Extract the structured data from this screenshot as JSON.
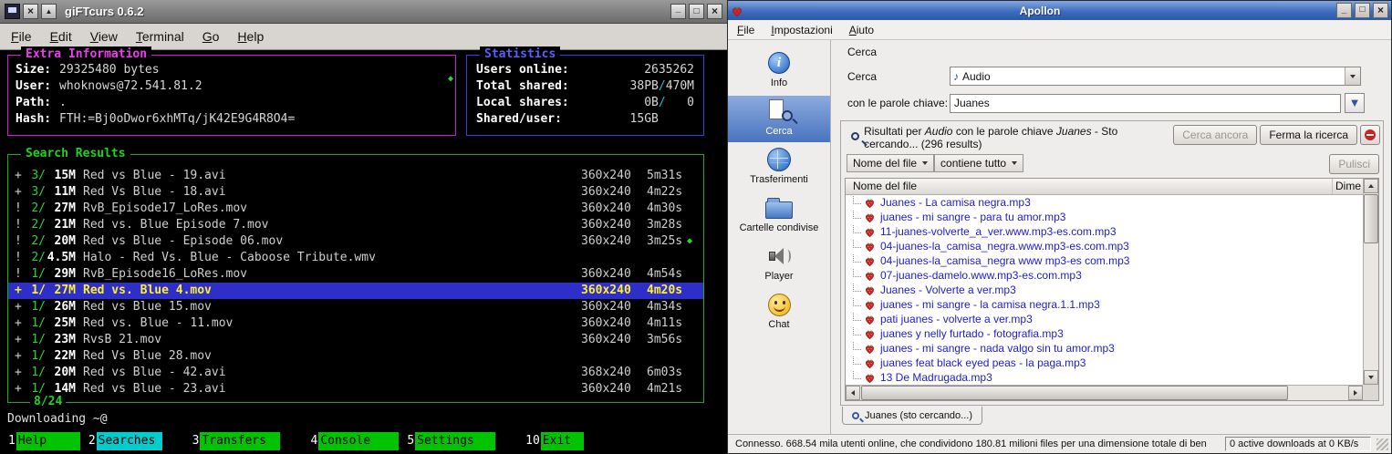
{
  "colors": {
    "terminal_green": "#1bd61b",
    "terminal_magenta": "#ee3cee",
    "terminal_blue": "#5d5dff",
    "terminal_cyan": "#18c5c5",
    "selection_bg": "#2e2ec9",
    "selection_fg": "#ffef2e",
    "fkey_green": "#00c400",
    "fkey_cyan": "#00cdcd",
    "kde_titlebar_blue": "#3c6dbd",
    "file_link_blue": "#2020c8"
  },
  "gift": {
    "window": {
      "title": "giFTcurs 0.6.2",
      "menu": [
        "File",
        "Edit",
        "View",
        "Terminal",
        "Go",
        "Help"
      ]
    },
    "extra_info": {
      "title": "Extra Information",
      "indicator": "◆",
      "rows": [
        {
          "label": "Size:",
          "value": "29325480 bytes"
        },
        {
          "label": "User:",
          "value": "whoknows@72.541.81.2"
        },
        {
          "label": "Path:",
          "value": "."
        },
        {
          "label": "Hash:",
          "value": "FTH:=Bj0oDwor6xhMTq/jK42E9G4R8O4="
        }
      ]
    },
    "statistics": {
      "title": "Statistics",
      "rows": [
        {
          "label": "Users online:",
          "v1": "2635262",
          "sl": "",
          "v2": ""
        },
        {
          "label": "Total shared:",
          "v1": "38PB",
          "sl": "/",
          "v2": "470M"
        },
        {
          "label": "Local shares:",
          "v1": "0B",
          "sl": "/",
          "v2": "   0"
        },
        {
          "label": "Shared/user:",
          "v1": "15GB     ",
          "sl": "",
          "v2": ""
        }
      ]
    },
    "search": {
      "title": "Search Results",
      "position": "8/24",
      "status_line": "Downloading ~@",
      "rows": [
        {
          "flag": "+",
          "count": "3/",
          "size": "15M",
          "name": "Red vs Blue - 19.avi",
          "res": "360x240",
          "time": "5m31s",
          "mark": "",
          "cls": ""
        },
        {
          "flag": "+",
          "count": "3/",
          "size": "11M",
          "name": "Red Vs Blue - 18.avi",
          "res": "360x240",
          "time": "4m22s",
          "mark": "",
          "cls": ""
        },
        {
          "flag": "!",
          "count": "2/",
          "size": "27M",
          "name": "RvB_Episode17_LoRes.mov",
          "res": "360x240",
          "time": "4m30s",
          "mark": "",
          "cls": ""
        },
        {
          "flag": "!",
          "count": "2/",
          "size": "21M",
          "name": "Red vs. Blue Episode 7.mov",
          "res": "360x240",
          "time": "3m28s",
          "mark": "",
          "cls": ""
        },
        {
          "flag": "!",
          "count": "2/",
          "size": "20M",
          "name": "Red vs Blue - Episode 06.mov",
          "res": "360x240",
          "time": "3m25s",
          "mark": "◆",
          "cls": ""
        },
        {
          "flag": "!",
          "count": "2/",
          "size": "4.5M",
          "name": "Halo - Red Vs. Blue - Caboose Tribute.wmv",
          "res": "",
          "time": "",
          "mark": "",
          "cls": ""
        },
        {
          "flag": "!",
          "count": "1/",
          "size": "29M",
          "name": "RvB_Episode16_LoRes.mov",
          "res": "360x240",
          "time": "4m54s",
          "mark": "",
          "cls": ""
        },
        {
          "flag": "+",
          "count": "1/",
          "size": "27M",
          "name": "Red vs. Blue 4.mov",
          "res": "360x240",
          "time": "4m20s",
          "mark": "",
          "cls": "selected"
        },
        {
          "flag": "+",
          "count": "1/",
          "size": "26M",
          "name": "Red vs Blue 15.mov",
          "res": "360x240",
          "time": "4m34s",
          "mark": "",
          "cls": ""
        },
        {
          "flag": "+",
          "count": "1/",
          "size": "25M",
          "name": "Red vs. Blue - 11.mov",
          "res": "360x240",
          "time": "4m11s",
          "mark": "",
          "cls": ""
        },
        {
          "flag": "+",
          "count": "1/",
          "size": "23M",
          "name": "RvsB 21.mov",
          "res": "360x240",
          "time": "3m56s",
          "mark": "",
          "cls": ""
        },
        {
          "flag": "+",
          "count": "1/",
          "size": "22M",
          "name": "Red Vs Blue 28.mov",
          "res": "",
          "time": "",
          "mark": "",
          "cls": ""
        },
        {
          "flag": "+",
          "count": "1/",
          "size": "20M",
          "name": "Red vs Blue - 42.avi",
          "res": "368x240",
          "time": "6m03s",
          "mark": "",
          "cls": ""
        },
        {
          "flag": "+",
          "count": "1/",
          "size": "14M",
          "name": "Red vs Blue - 23.avi",
          "res": "360x240",
          "time": "4m21s",
          "mark": "",
          "cls": ""
        }
      ]
    },
    "fkeys": [
      {
        "key": "1",
        "label": "Help",
        "cls": ""
      },
      {
        "key": "2",
        "label": "Searches",
        "cls": "active"
      },
      {
        "key": "3",
        "label": "Transfers",
        "cls": ""
      },
      {
        "key": "4",
        "label": "Console",
        "cls": ""
      },
      {
        "key": "5",
        "label": "Settings",
        "cls": ""
      },
      {
        "key": "10",
        "label": "Exit",
        "cls": ""
      }
    ]
  },
  "apollon": {
    "window": {
      "title": "Apollon",
      "menu": [
        "File",
        "Impostazioni",
        "Aiuto"
      ]
    },
    "sidebar": [
      {
        "label": "Info"
      },
      {
        "label": "Cerca"
      },
      {
        "label": "Trasferimenti"
      },
      {
        "label": "Cartelle condivise"
      },
      {
        "label": "Player"
      },
      {
        "label": "Chat"
      }
    ],
    "page": {
      "heading": "Cerca",
      "search_label": "Cerca",
      "media_value": "Audio",
      "keywords_label": "con le parole chiave:",
      "keywords_value": "Juanes",
      "results": {
        "prefix": "Risultati per ",
        "media": "Audio",
        "middle": " con le parole chiave ",
        "keyword": "Juanes",
        "suffix": " - Sto cercando... (296 results)"
      },
      "buttons": {
        "search_again": "Cerca ancora",
        "stop_search": "Ferma la ricerca",
        "clear": "Pulisci"
      },
      "filters": {
        "field": "Nome del file",
        "condition": "contiene tutto"
      },
      "table": {
        "col_name": "Nome del file",
        "col_size": "Dime",
        "files": [
          "Juanes - La camisa negra.mp3",
          "juanes - mi sangre - para tu amor.mp3",
          "11-juanes-volverte_a_ver.www.mp3-es.com.mp3",
          "04-juanes-la_camisa_negra.www.mp3-es.com.mp3",
          "04-juanes-la_camisa_negra www mp3-es com.mp3",
          "07-juanes-damelo.www.mp3-es.com.mp3",
          "Juanes - Volverte a ver.mp3",
          "juanes - mi sangre - la camisa negra.1.1.mp3",
          "pati juanes - volverte a ver.mp3",
          "juanes y nelly furtado - fotografia.mp3",
          "juanes - mi sangre - nada valgo sin tu amor.mp3",
          "juanes feat black eyed peas - la paga.mp3",
          "13 De Madrugada.mp3"
        ]
      },
      "tab_label": "Juanes (sto cercando...)"
    },
    "statusbar": {
      "left": "Connesso. 668.54 mila utenti online, che condividono 180.81 milioni files per una dimensione totale di ben",
      "right": "0 active downloads at 0 KB/s"
    }
  }
}
